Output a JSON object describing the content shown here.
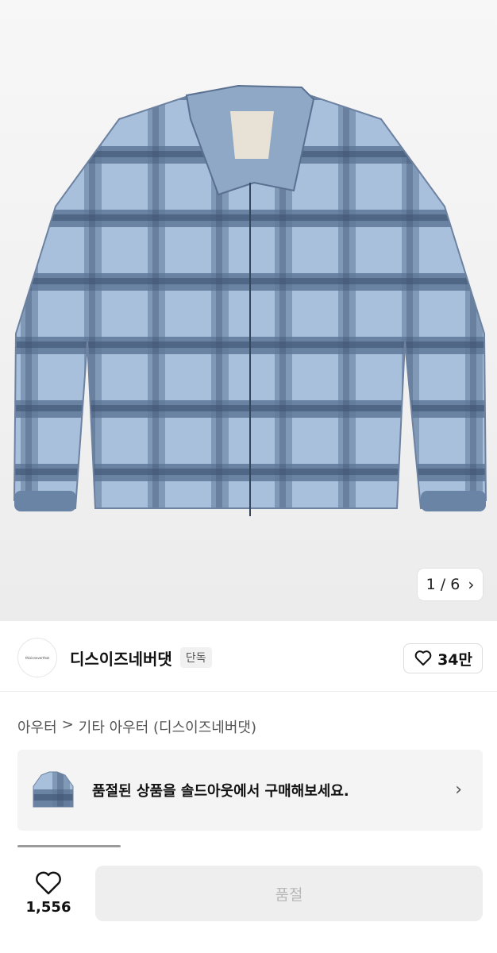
{
  "product_image": {
    "alt": "blue plaid fleece jacket",
    "pager": {
      "current": "1",
      "separator": "/",
      "total": "6",
      "text": "1 / 6"
    }
  },
  "brand": {
    "name": "디스이즈네버댓",
    "badge": "단독",
    "logo_text": "thisisneverthat",
    "likes": "34만"
  },
  "breadcrumb": {
    "items": [
      "아우터",
      "기타 아우터 (디스이즈네버댓)"
    ],
    "separator": ">"
  },
  "soldout_banner": {
    "text": "품절된 상품을 솔드아웃에서 구매해보세요."
  },
  "bottom_bar": {
    "like_count": "1,556",
    "buy_label": "품절"
  },
  "colors": {
    "jacket_light": "#a8c0dc",
    "jacket_dark": "#4e6785",
    "button_bg": "#eeeeee",
    "button_text": "#b8b8b8"
  }
}
